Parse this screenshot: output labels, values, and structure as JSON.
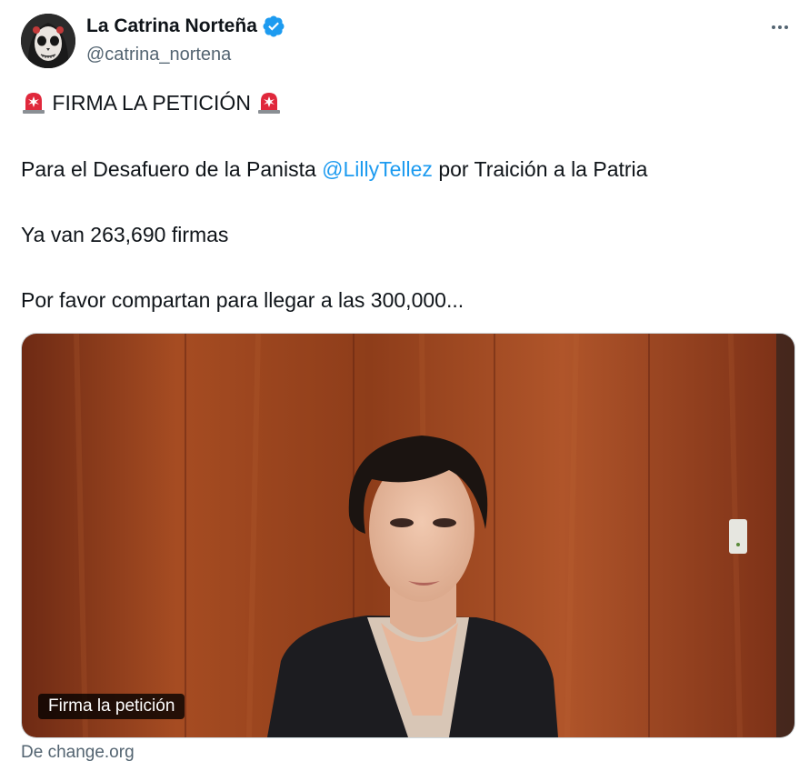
{
  "author": {
    "display_name": "La Catrina Norteña",
    "handle": "@catrina_nortena",
    "verified": true,
    "avatar_icon": "catrina-skull-avatar"
  },
  "menu": {
    "icon": "more-horizontal-icon"
  },
  "tweet": {
    "line1_text": "FIRMA LA PETICIÓN",
    "line1_emoji": "police-siren-emoji",
    "line2_before": "Para el Desafuero de la Panista ",
    "line2_mention": "@LillyTellez",
    "line2_after": " por Traición a la Patria",
    "line3": "Ya van 263,690 firmas",
    "line4": "Por favor compartan para llegar a las 300,000..."
  },
  "card": {
    "label": "Firma la petición",
    "source": "De change.org"
  },
  "colors": {
    "text": "#0f1419",
    "secondary": "#536471",
    "link": "#1d9bf0",
    "verified": "#1d9bf0",
    "siren_red": "#e0283c"
  }
}
